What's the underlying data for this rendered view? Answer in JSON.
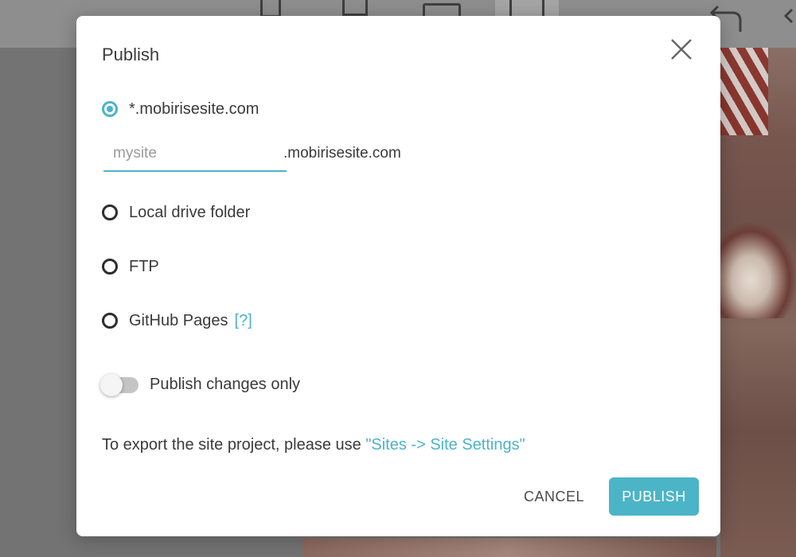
{
  "dialog": {
    "title": "Publish",
    "close_icon": "close-icon",
    "options": [
      {
        "label": "*.mobirisesite.com",
        "checked": true
      },
      {
        "label": "Local drive folder",
        "checked": false
      },
      {
        "label": "FTP",
        "checked": false
      },
      {
        "label": "GitHub Pages",
        "checked": false,
        "help": "[?]"
      }
    ],
    "subdomain": {
      "placeholder": "mysite",
      "value": "",
      "suffix": ".mobirisesite.com"
    },
    "toggle": {
      "label": "Publish changes only",
      "on": false
    },
    "export_note": {
      "text": "To export the site project, please use ",
      "link": "\"Sites -> Site Settings\""
    },
    "buttons": {
      "cancel": "CANCEL",
      "publish": "PUBLISH"
    }
  },
  "colors": {
    "accent": "#4cb4c7",
    "text": "#3a3a3a",
    "overlay": "#737373"
  },
  "background": {
    "toolbar_icons": [
      "mobile-view-icon",
      "tablet-view-icon",
      "laptop-view-icon",
      "desktop-view-icon",
      "undo-icon",
      "redo-icon"
    ]
  }
}
